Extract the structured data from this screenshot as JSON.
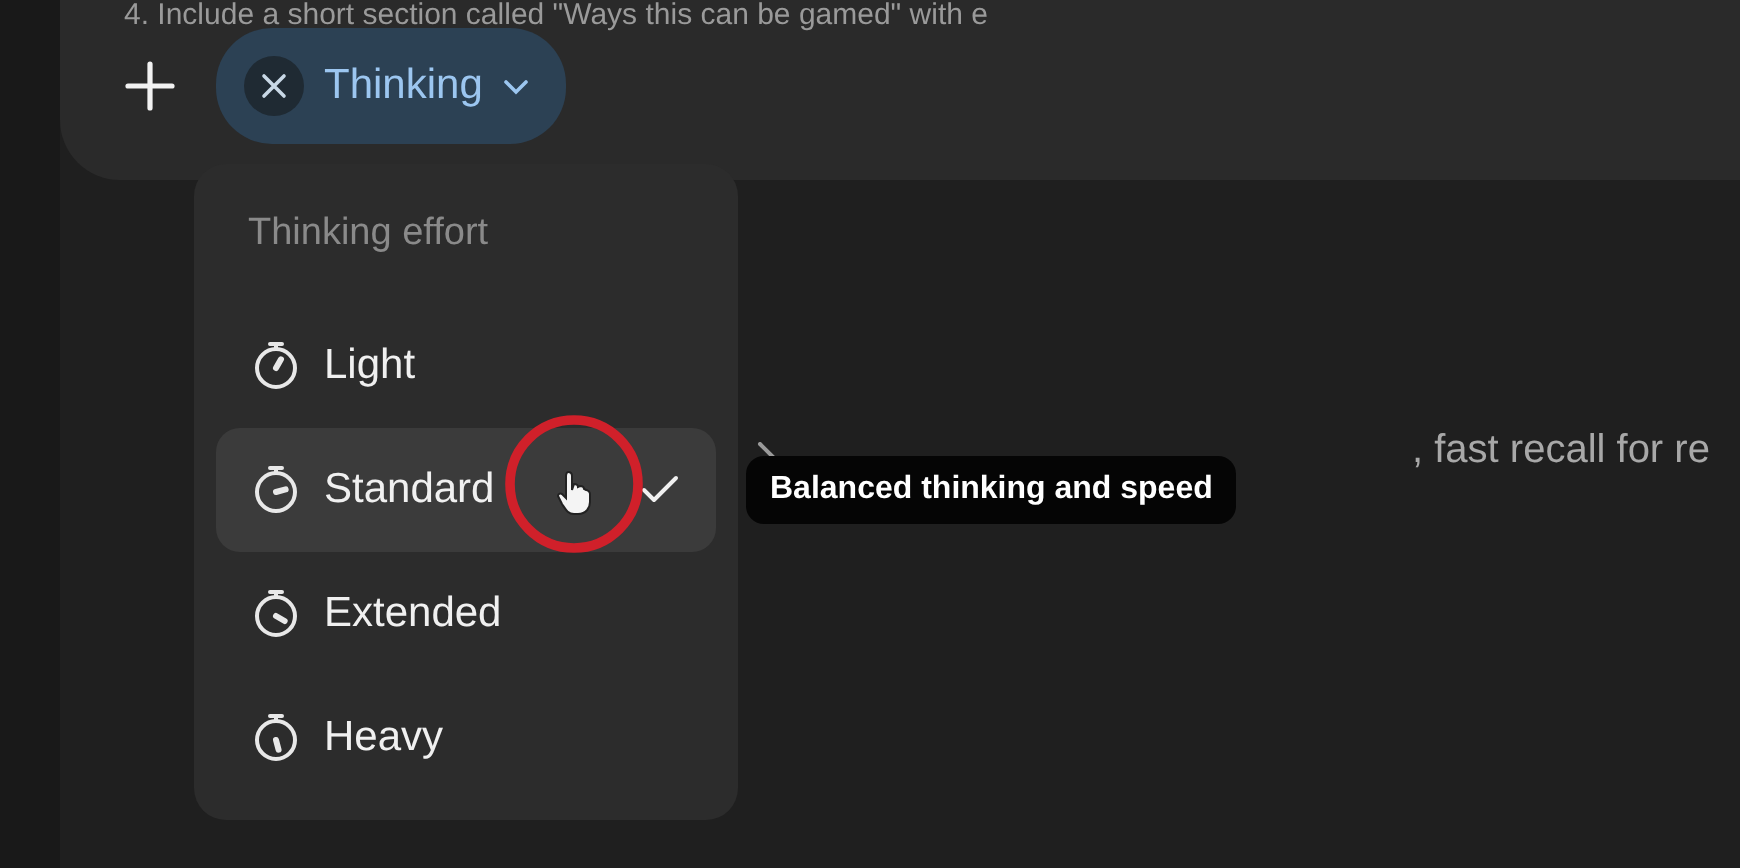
{
  "composer": {
    "prompt_text": "4. Include a short section called \"Ways this can be gamed\" with e",
    "chip": {
      "label": "Thinking"
    }
  },
  "menu": {
    "title": "Thinking effort",
    "items": [
      {
        "label": "Light",
        "selected": false
      },
      {
        "label": "Standard",
        "selected": true
      },
      {
        "label": "Extended",
        "selected": false
      },
      {
        "label": "Heavy",
        "selected": false
      }
    ]
  },
  "tooltip": "Balanced thinking and speed",
  "background_line": ", fast recall for re"
}
